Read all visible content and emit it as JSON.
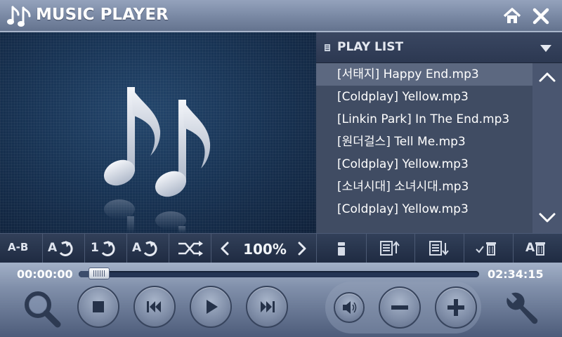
{
  "window": {
    "title": "MUSIC PLAYER",
    "icons": {
      "logo": "music-notes-icon",
      "home": "home-icon",
      "close": "close-icon"
    }
  },
  "album_art": {
    "icon": "music-notes-icon"
  },
  "playlist": {
    "header": "PLAY LIST",
    "items": [
      "[서태지] Happy End.mp3",
      "[Coldplay] Yellow.mp3",
      "[Linkin Park] In The End.mp3",
      "[원더걸스] Tell Me.mp3",
      "[Coldplay] Yellow.mp3",
      "[소녀시대] 소녀시대.mp3",
      "[Coldplay] Yellow.mp3"
    ],
    "selected_index": 0
  },
  "controls": {
    "ab_label": "A-B",
    "repeat_all_label": "A",
    "repeat_one_label": "1",
    "repeat_all2_label": "A",
    "speed": "100%",
    "playlist_buttons": [
      "remove-icon",
      "move-up-icon",
      "move-down-icon",
      "delete-checked-icon",
      "delete-all-icon"
    ],
    "delete_all_label": "A"
  },
  "playback": {
    "elapsed": "00:00:00",
    "total": "02:34:15",
    "progress": 0.05
  },
  "colors": {
    "accent": "#8ea0bf",
    "selected_row": "#5c6880",
    "title_text": "#ffffff"
  }
}
